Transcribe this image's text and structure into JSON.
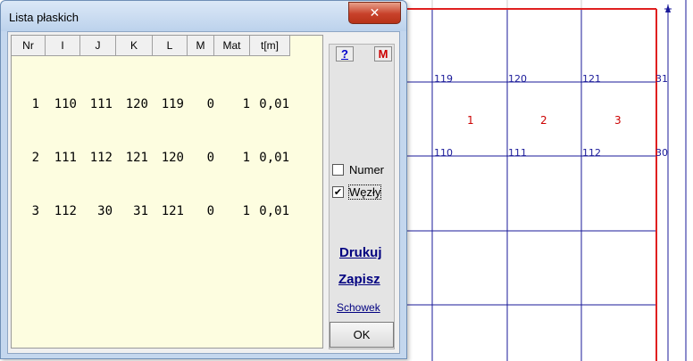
{
  "window": {
    "title": "Lista płaskich",
    "close_glyph": "✕"
  },
  "table": {
    "headers": [
      "Nr",
      "I",
      "J",
      "K",
      "L",
      "M",
      "Mat",
      "t[m]"
    ],
    "rows": [
      [
        "1",
        "110",
        "111",
        "120",
        "119",
        "0",
        "1",
        "0,01"
      ],
      [
        "2",
        "111",
        "112",
        "121",
        "120",
        "0",
        "1",
        "0,01"
      ],
      [
        "3",
        "112",
        "30",
        "31",
        "121",
        "0",
        "1",
        "0,01"
      ]
    ]
  },
  "panel": {
    "help_label": "?",
    "m_label": "M",
    "numer": {
      "label": "Numer",
      "checked": false
    },
    "wezly": {
      "label": "Węzły",
      "checked": true
    },
    "drukuj_label": "Drukuj",
    "zapisz_label": "Zapisz",
    "schowek_label": "Schowek",
    "ok_label": "OK"
  },
  "drawing": {
    "nodes_top": [
      "119",
      "120",
      "121",
      "31"
    ],
    "nodes_bottom": [
      "110",
      "111",
      "112",
      "30"
    ],
    "elements": [
      "1",
      "2",
      "3"
    ],
    "colors": {
      "boundary": "#e02020",
      "line": "#1a1a99",
      "element_label": "#cc0000"
    }
  }
}
